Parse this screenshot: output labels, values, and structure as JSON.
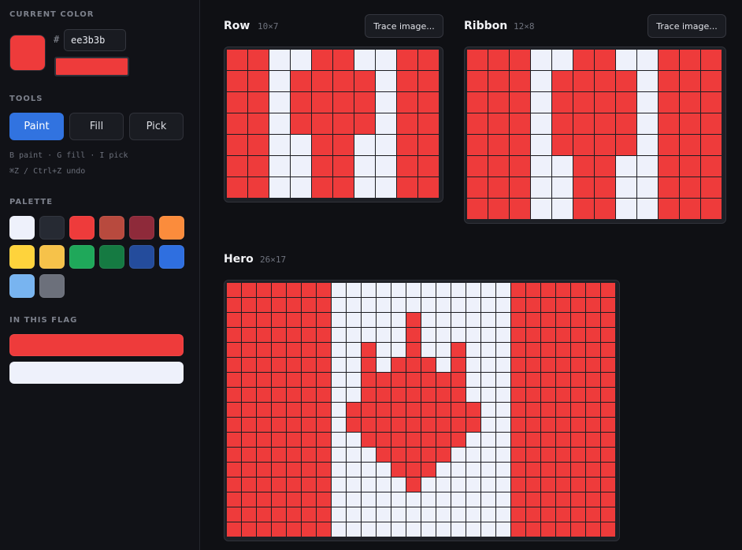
{
  "sidebar": {
    "current_color_title": "CURRENT COLOR",
    "hash": "#",
    "hex_value": "ee3b3b",
    "current_color": "#ee3b3b",
    "tools_title": "TOOLS",
    "tools": [
      {
        "label": "Paint",
        "active": true
      },
      {
        "label": "Fill",
        "active": false
      },
      {
        "label": "Pick",
        "active": false
      }
    ],
    "hint_line1": "B paint · G fill · I pick",
    "hint_line2": "⌘Z / Ctrl+Z undo",
    "palette_title": "PALETTE",
    "palette": [
      "#eef1fb",
      "#262a33",
      "#ee3b3b",
      "#b84a3e",
      "#8e2a3a",
      "#fb8c3c",
      "#fed33c",
      "#f6c24a",
      "#1fa85a",
      "#157a42",
      "#244c9c",
      "#2f6fe0",
      "#78b4f0",
      "#6c707b"
    ],
    "in_flag_title": "IN THIS FLAG",
    "flag_colors": [
      "#ee3b3b",
      "#eef1fb"
    ]
  },
  "colors": {
    "R": "#ee3b3b",
    "W": "#eef1fb"
  },
  "panels": {
    "row": {
      "title": "Row",
      "dims": "10×7",
      "trace_label": "Trace image...",
      "rows": [
        "RRWWRRWWRR",
        "RRWRRRRWRR",
        "RRWRRRRWRR",
        "RRWRRRRWRR",
        "RRWWRRWWRR",
        "RRWWRRWWRR",
        "RRWWRRWWRR"
      ]
    },
    "ribbon": {
      "title": "Ribbon",
      "dims": "12×8",
      "trace_label": "Trace image...",
      "rows": [
        "RRRWWRRWWRRR",
        "RRRWRRRRWRRR",
        "RRRWRRRRWRRR",
        "RRRWRRRRWRRR",
        "RRRWRRRRWRRR",
        "RRRWWRRWWRRR",
        "RRRWWRRWWRRR",
        "RRRWWRRWWRRR"
      ]
    },
    "hero": {
      "title": "Hero",
      "dims": "26×17",
      "rows": [
        "RRRRRRRWWWWWWWWWWWWRRRRRRR",
        "RRRRRRRWWWWWWWWWWWWRRRRRRR",
        "RRRRRRRWWWWWRWWWWWWRRRRRRR",
        "RRRRRRRWWWWWRWWWWWWRRRRRRR",
        "RRRRRRRWWRWWRWWRWWWRRRRRRR",
        "RRRRRRRWWRWRRRWRWWWRRRRRRR",
        "RRRRRRRWWRRRRRRRWWWRRRRRRR",
        "RRRRRRRWWRRRRRRRWWWRRRRRRR",
        "RRRRRRRWRRRRRRRRRWWRRRRRRR",
        "RRRRRRRWRRRRRRRRRWWRRRRRRR",
        "RRRRRRRWWRRRRRRRWWWRRRRRRR",
        "RRRRRRRWWWRRRRRWWWWRRRRRRR",
        "RRRRRRRWWWWRRRWWWWWRRRRRRR",
        "RRRRRRRWWWWWRWWWWWWRRRRRRR",
        "RRRRRRRWWWWWWWWWWWWRRRRRRR",
        "RRRRRRRWWWWWWWWWWWWRRRRRRR",
        "RRRRRRRWWWWWWWWWWWWRRRRRRR"
      ]
    }
  }
}
